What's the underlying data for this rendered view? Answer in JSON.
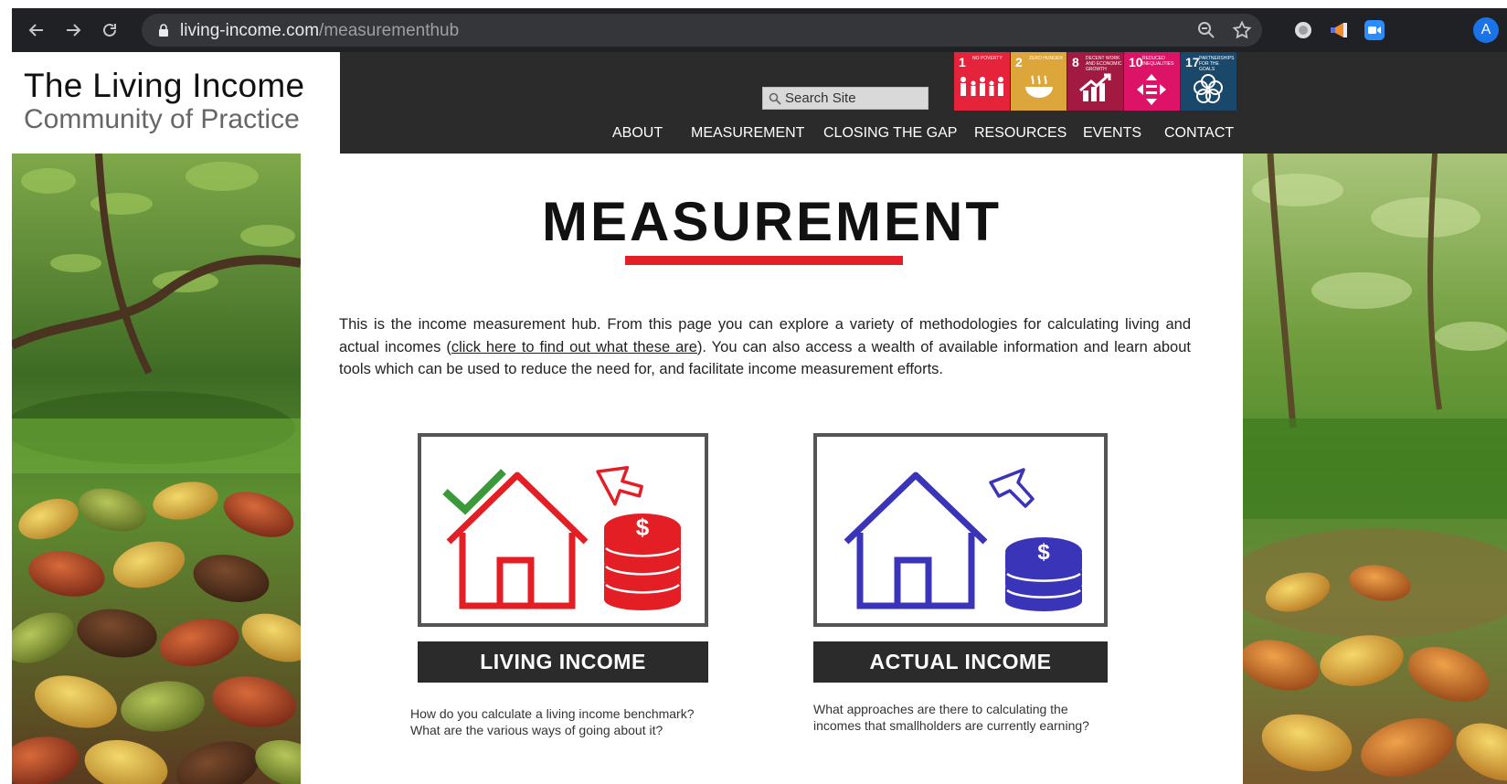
{
  "browser": {
    "url_domain": "living-income.com",
    "url_path": "/measurementhub",
    "profile_initial": "A",
    "icons": [
      "back-icon",
      "forward-icon",
      "reload-icon",
      "lock-icon",
      "zoom-icon",
      "star-icon",
      "extension-icon",
      "megaphone-extension-icon",
      "zoom-meeting-extension-icon"
    ]
  },
  "header": {
    "logo_title": "The Living Income",
    "logo_subtitle": "Community of Practice",
    "search_placeholder": "Search Site",
    "sdg_goals": [
      {
        "number": "1",
        "label": "NO POVERTY",
        "color": "#e5243b"
      },
      {
        "number": "2",
        "label": "ZERO HUNGER",
        "color": "#dda63a"
      },
      {
        "number": "8",
        "label": "DECENT WORK AND ECONOMIC GROWTH",
        "color": "#a21942"
      },
      {
        "number": "10",
        "label": "REDUCED INEQUALITIES",
        "color": "#dd1367"
      },
      {
        "number": "17",
        "label": "PARTNERSHIPS FOR THE GOALS",
        "color": "#19486a"
      }
    ],
    "nav": [
      "ABOUT",
      "MEASUREMENT",
      "CLOSING THE GAP",
      "RESOURCES",
      "EVENTS",
      "CONTACT"
    ]
  },
  "main": {
    "title": "MEASUREMENT",
    "intro_before": "This is the income measurement hub. From this page you can explore a variety of methodologies for calculating living and actual incomes (",
    "intro_link": "click here to find out what these are",
    "intro_after": "). You can also access a wealth of available information and learn about tools which can be used to reduce the need for, and facilitate income measurement efforts.",
    "cards": [
      {
        "label": "LIVING INCOME",
        "description_1": "How do you calculate a living income benchmark?",
        "description_2": "What are the various ways of going about it?",
        "color": "#e31e24"
      },
      {
        "label": "ACTUAL INCOME",
        "description_1": "What approaches are there to calculating the",
        "description_2": "incomes that smallholders are currently earning?",
        "color": "#3a35b8"
      }
    ]
  },
  "colors": {
    "accent_red": "#e31e24",
    "header_dark": "#2b2b2b",
    "actual_blue": "#3a35b8"
  }
}
